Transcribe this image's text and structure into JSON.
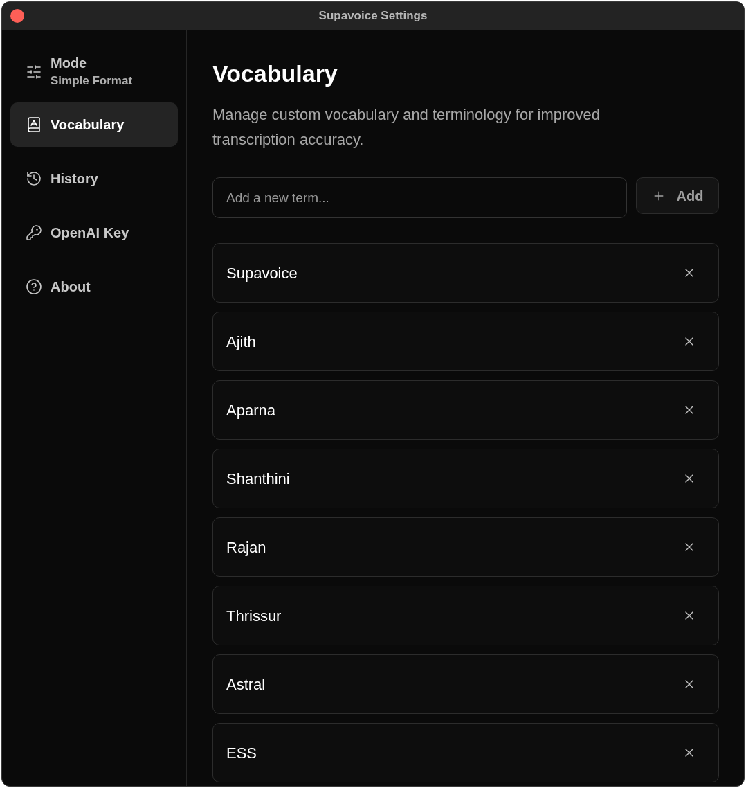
{
  "window": {
    "title": "Supavoice Settings"
  },
  "sidebar": {
    "items": [
      {
        "label": "Mode",
        "subtitle": "Simple Format",
        "selected": false
      },
      {
        "label": "Vocabulary",
        "selected": true
      },
      {
        "label": "History",
        "selected": false
      },
      {
        "label": "OpenAI Key",
        "selected": false
      },
      {
        "label": "About",
        "selected": false
      }
    ]
  },
  "page": {
    "title": "Vocabulary",
    "description": "Manage custom vocabulary and terminology for improved transcription accuracy."
  },
  "new_term": {
    "placeholder": "Add a new term...",
    "button": "Add"
  },
  "terms": [
    "Supavoice",
    "Ajith",
    "Aparna",
    "Shanthini",
    "Rajan",
    "Thrissur",
    "Astral",
    "ESS"
  ]
}
